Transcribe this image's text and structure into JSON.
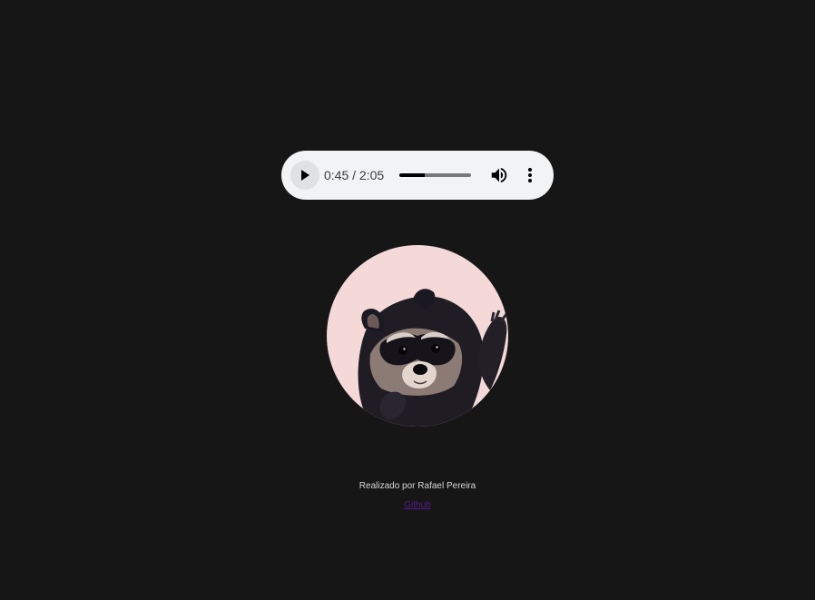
{
  "audio_player": {
    "time_display": "0:45 / 2:05",
    "progress_fraction": 0.36,
    "play_icon": "play-icon",
    "volume_icon": "volume-icon",
    "more_icon": "more-vertical-icon"
  },
  "avatar": {
    "background_color": "#f5d9d8"
  },
  "footer": {
    "credit": "Realizado por Rafael Pereira",
    "github_label": "Github"
  },
  "colors": {
    "page_background": "#161616",
    "player_background": "#f1f3f4",
    "link_visited": "#551a8b"
  }
}
